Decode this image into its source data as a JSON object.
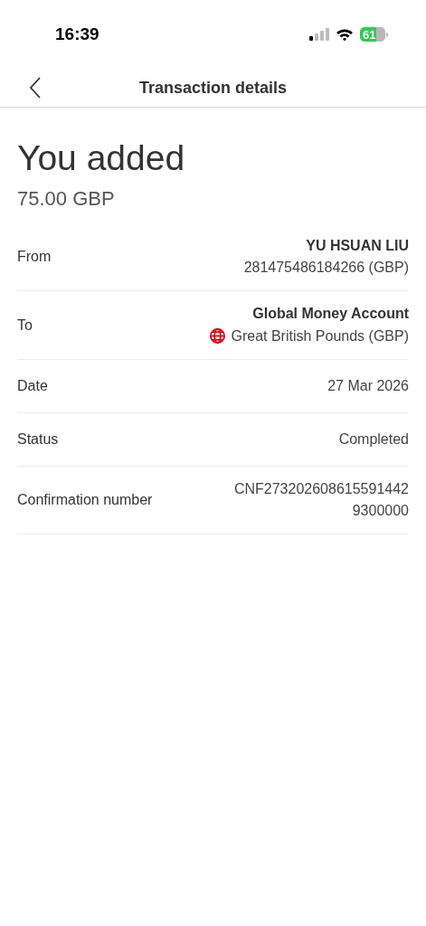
{
  "status_bar": {
    "time": "16:39",
    "battery": "61"
  },
  "header": {
    "title": "Transaction details"
  },
  "summary": {
    "heading": "You added",
    "amount": "75.00 GBP"
  },
  "rows": [
    {
      "label": "From",
      "lines": [
        {
          "kind": "bold",
          "text": "YU HSUAN LIU"
        },
        {
          "kind": "plain",
          "text": "281475486184266 (GBP)"
        }
      ]
    },
    {
      "label": "To",
      "lines": [
        {
          "kind": "bold",
          "text": "Global Money Account"
        },
        {
          "kind": "currency",
          "text": "Great British Pounds (GBP)"
        }
      ]
    },
    {
      "label": "Date",
      "lines": [
        {
          "kind": "plain",
          "text": "27 Mar 2026"
        }
      ]
    },
    {
      "label": "Status",
      "lines": [
        {
          "kind": "plain",
          "text": "Completed"
        }
      ]
    },
    {
      "label": "Confirmation number",
      "lines": [
        {
          "kind": "plain",
          "text": "CNF273202608615591442"
        },
        {
          "kind": "plain",
          "text": "9300000"
        }
      ]
    }
  ]
}
